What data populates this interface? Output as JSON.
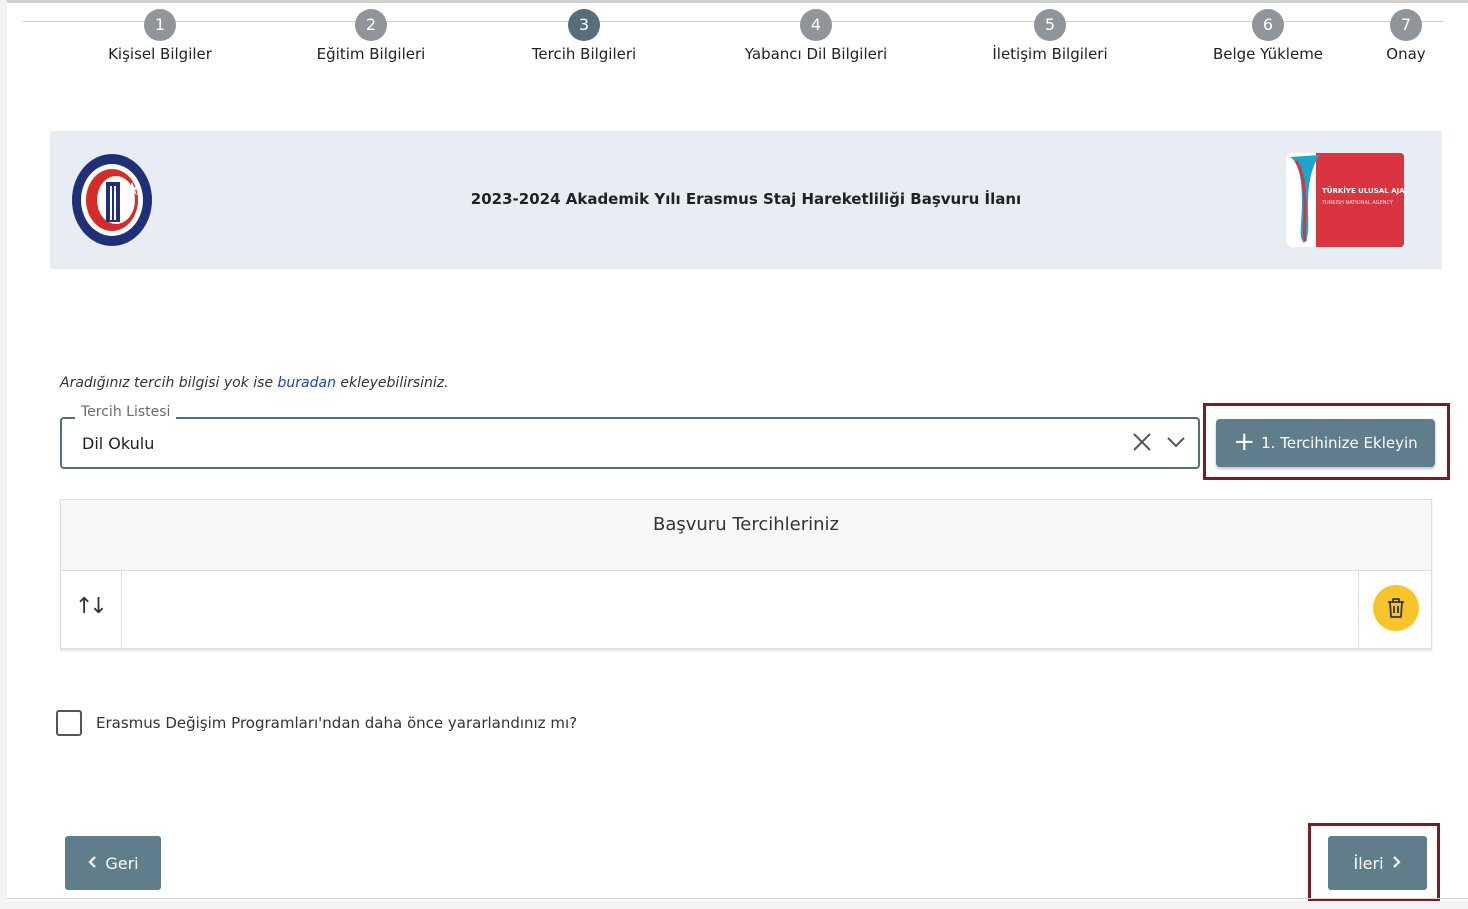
{
  "stepper": {
    "steps": [
      {
        "num": "1",
        "label": "Kişisel Bilgiler"
      },
      {
        "num": "2",
        "label": "Eğitim Bilgileri"
      },
      {
        "num": "3",
        "label": "Tercih Bilgileri"
      },
      {
        "num": "4",
        "label": "Yabancı Dil Bilgileri"
      },
      {
        "num": "5",
        "label": "İletişim Bilgileri"
      },
      {
        "num": "6",
        "label": "Belge Yükleme"
      },
      {
        "num": "7",
        "label": "Onay"
      }
    ],
    "active_step": "3"
  },
  "banner": {
    "title": "2023-2024 Akademik Yılı Erasmus Staj Hareketliliği Başvuru İlanı",
    "right_logo_text": "TÜRKİYE ULUSAL AJANSI",
    "right_logo_subtext": "TURKISH NATIONAL AGENCY"
  },
  "hint": {
    "before": "Aradığınız tercih bilgisi yok ise ",
    "link": "buradan",
    "after": " ekleyebilirsiniz."
  },
  "preference_select": {
    "legend": "Tercih Listesi",
    "value": "Dil Okulu"
  },
  "add_button": {
    "icon": "plus-icon",
    "label": "1. Tercihinize Ekleyin"
  },
  "preferences_table": {
    "header": "Başvuru Tercihleriniz"
  },
  "checkbox": {
    "label": "Erasmus Değişim Programları'ndan daha önce yararlandınız mı?",
    "checked": false
  },
  "nav": {
    "back_label": "Geri",
    "next_label": "İleri"
  },
  "colors": {
    "step_active": "#566d7c",
    "step_inactive": "#8f9599",
    "button": "#607d8b",
    "delete_button": "#f7c52b",
    "highlight_box": "#7b1b22",
    "link": "#1a3fd1"
  }
}
